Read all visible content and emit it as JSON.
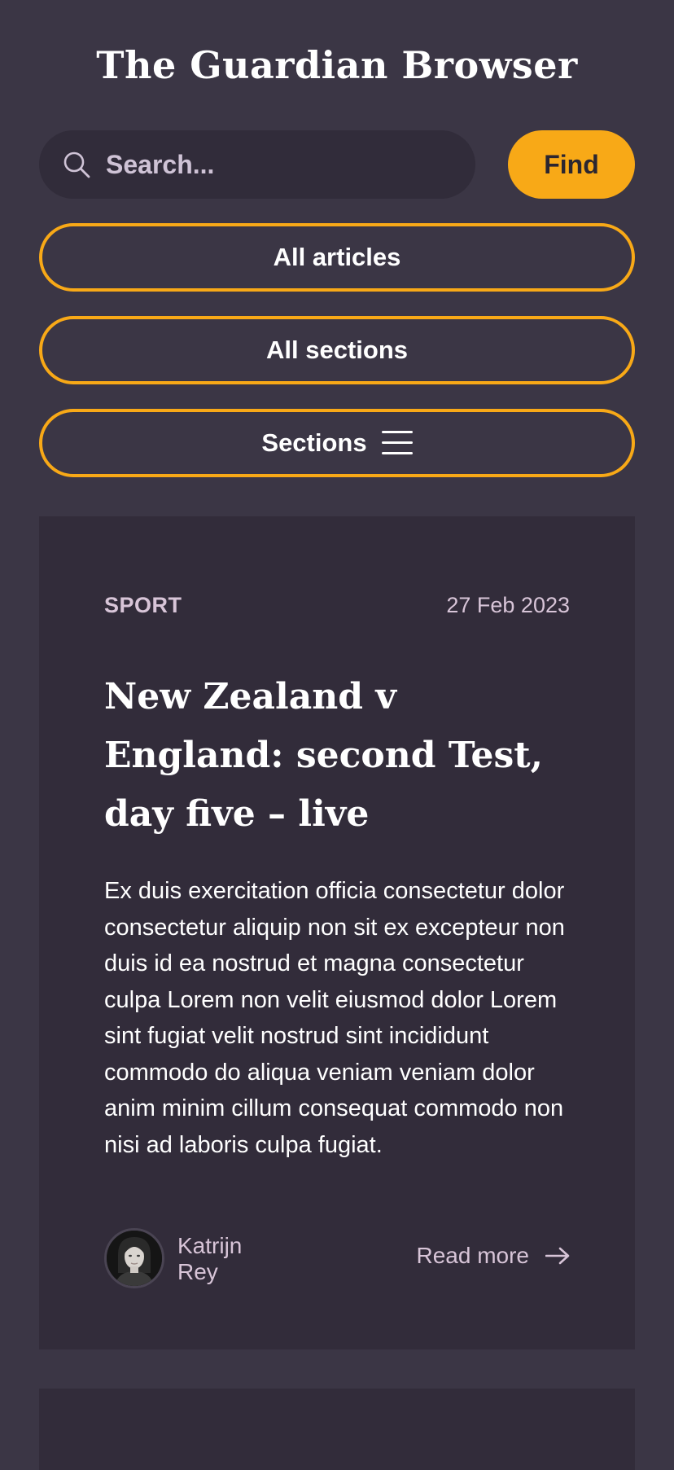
{
  "header": {
    "title": "The Guardian Browser"
  },
  "search": {
    "placeholder": "Search...",
    "value": "",
    "find_label": "Find"
  },
  "nav": {
    "all_articles": "All articles",
    "all_sections": "All sections",
    "sections": "Sections"
  },
  "articles": [
    {
      "section": "SPORT",
      "date": "27 Feb 2023",
      "title": "New Zealand v England: second Test, day five – live",
      "body": "Ex duis exercitation officia consectetur dolor consectetur aliquip non sit ex excepteur non duis id ea nostrud et magna consectetur culpa Lorem non velit eiusmod dolor Lorem sint fugiat velit nostrud sint incididunt commodo do aliqua veniam veniam dolor anim minim cillum consequat commodo non nisi ad laboris culpa fugiat.",
      "author_first": "Katrijn",
      "author_last": "Rey",
      "read_more": "Read more"
    }
  ],
  "colors": {
    "background": "#3b3645",
    "card": "#322c3a",
    "accent": "#f8a917",
    "muted_text": "#d8c5d8"
  },
  "icons": {
    "search": "search-icon",
    "menu": "hamburger-menu-icon",
    "arrow": "arrow-right-icon"
  }
}
